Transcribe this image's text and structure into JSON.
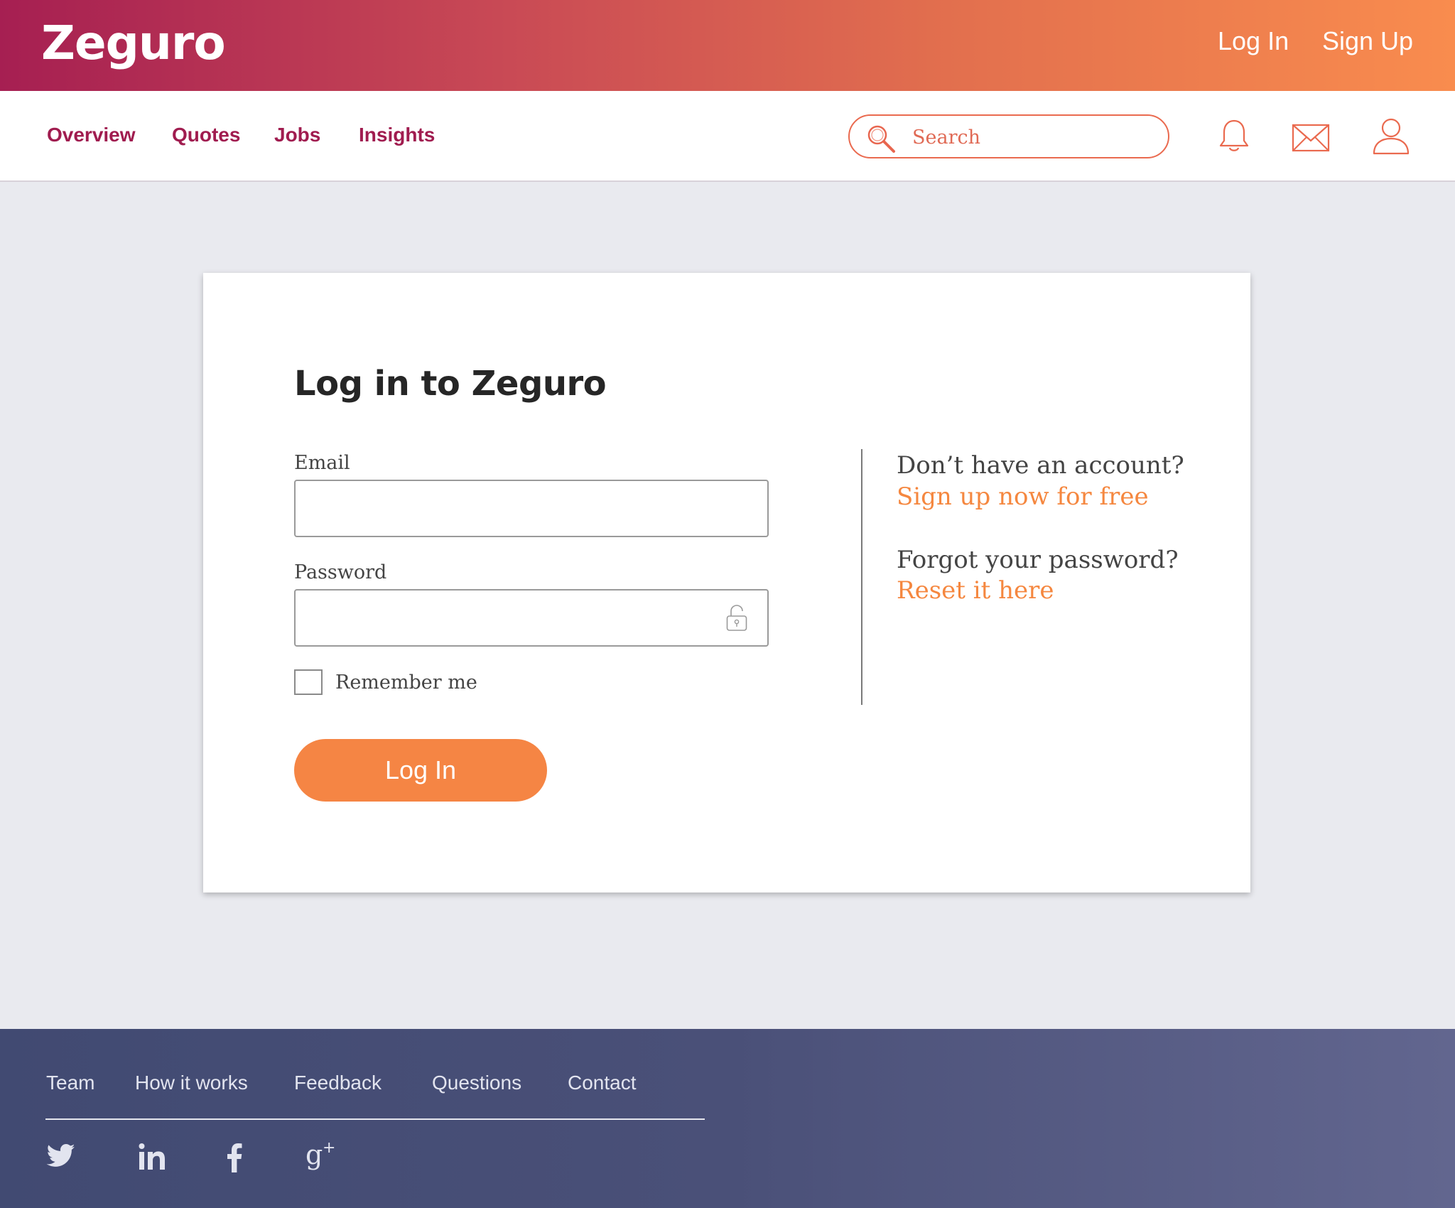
{
  "header": {
    "logo": "Zeguro",
    "login_label": "Log In",
    "signup_label": "Sign Up"
  },
  "nav": {
    "items": [
      {
        "label": "Overview"
      },
      {
        "label": "Quotes"
      },
      {
        "label": "Jobs"
      },
      {
        "label": "Insights"
      }
    ],
    "search_placeholder": "Search",
    "icons": [
      "bell-icon",
      "mail-icon",
      "user-icon"
    ]
  },
  "login": {
    "title": "Log in to Zeguro",
    "email_label": "Email",
    "email_value": "",
    "password_label": "Password",
    "password_value": "",
    "remember_label": "Remember me",
    "remember_checked": false,
    "submit_label": "Log In"
  },
  "side": {
    "no_account": "Don’t have an account?",
    "signup_link": "Sign up now for free",
    "forgot": "Forgot your password?",
    "reset_link": "Reset it here"
  },
  "footer": {
    "links": [
      {
        "label": "Team"
      },
      {
        "label": "How it works"
      },
      {
        "label": "Feedback"
      },
      {
        "label": "Questions"
      },
      {
        "label": "Contact"
      }
    ],
    "social": [
      "twitter-icon",
      "linkedin-icon",
      "facebook-icon",
      "google-plus-icon"
    ]
  },
  "colors": {
    "brand_magenta": "#a01c4f",
    "brand_orange": "#f58544",
    "footer_navy": "#454d76",
    "page_bg": "#e9eaef"
  }
}
